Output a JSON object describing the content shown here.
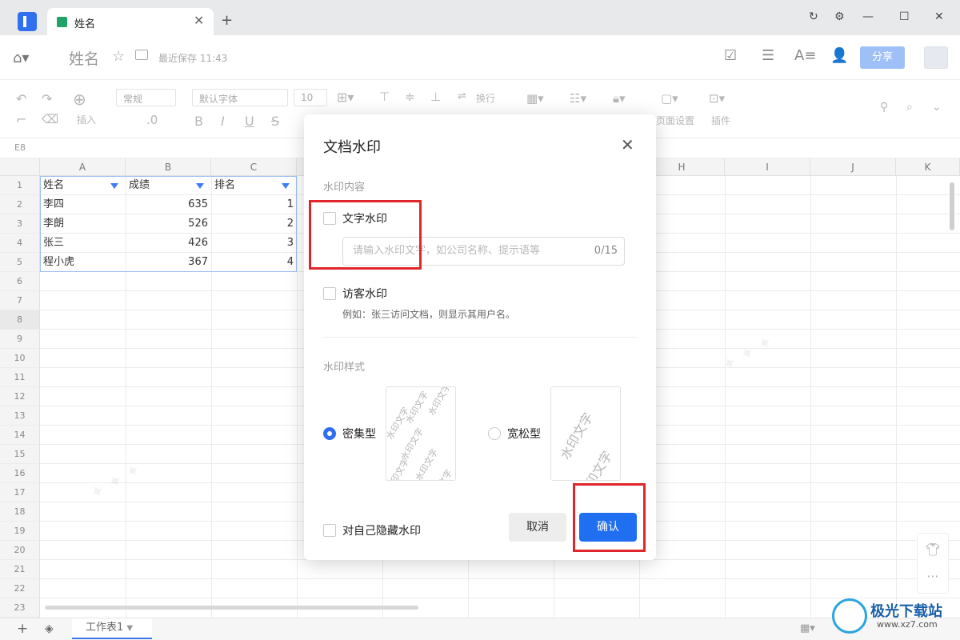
{
  "window": {
    "tab_title": "姓名",
    "new_tab": "+",
    "controls": [
      "refresh-icon",
      "settings-icon",
      "minimize-icon",
      "maximize-icon",
      "close-icon"
    ]
  },
  "header": {
    "doc_title": "姓名",
    "save_status": "最近保存 11:43",
    "share_label": "分享"
  },
  "toolbar": {
    "insert_label": "插入",
    "format_select": "常规",
    "font_select": "默认字体",
    "size_select": "10",
    "decimal": ".0",
    "wrap_label": "换行",
    "page_setup_label": "页面设置",
    "plugin_label": "插件",
    "bold": "B",
    "italic": "I",
    "underline": "U",
    "strike": "S"
  },
  "formula": {
    "cell_ref": "E8"
  },
  "grid": {
    "columns": [
      "A",
      "B",
      "C",
      "D",
      "E",
      "F",
      "G",
      "H",
      "I",
      "J",
      "K"
    ],
    "rows": [
      "1",
      "2",
      "3",
      "4",
      "5",
      "6",
      "7",
      "8",
      "9",
      "10",
      "11",
      "12",
      "13",
      "14",
      "15",
      "16",
      "17",
      "18",
      "19",
      "20",
      "21",
      "22",
      "23"
    ],
    "headers": [
      "姓名",
      "成绩",
      "排名"
    ],
    "data": [
      [
        "李四",
        "635",
        "1"
      ],
      [
        "李朗",
        "526",
        "2"
      ],
      [
        "张三",
        "426",
        "3"
      ],
      [
        "程小虎",
        "367",
        "4"
      ]
    ]
  },
  "sheet": {
    "name": "工作表1",
    "add": "+"
  },
  "dialog": {
    "title": "文档水印",
    "content_section": "水印内容",
    "text_wm_label": "文字水印",
    "input_placeholder": "请输入水印文字，如公司名称、提示语等",
    "counter": "0/15",
    "visitor_wm_label": "访客水印",
    "visitor_hint": "例如：张三访问文档，则显示其用户名。",
    "style_section": "水印样式",
    "dense_label": "密集型",
    "loose_label": "宽松型",
    "preview_text": "水印文字",
    "hide_self_label": "对自己隐藏水印",
    "cancel_label": "取消",
    "ok_label": "确认",
    "selected_style": "dense"
  },
  "watermark": {
    "brand": "极光下载站",
    "url": "www.xz7.com"
  },
  "colors": {
    "accent": "#1f6ff0",
    "highlight": "#e0262b",
    "filter": "#3f7cf0"
  }
}
